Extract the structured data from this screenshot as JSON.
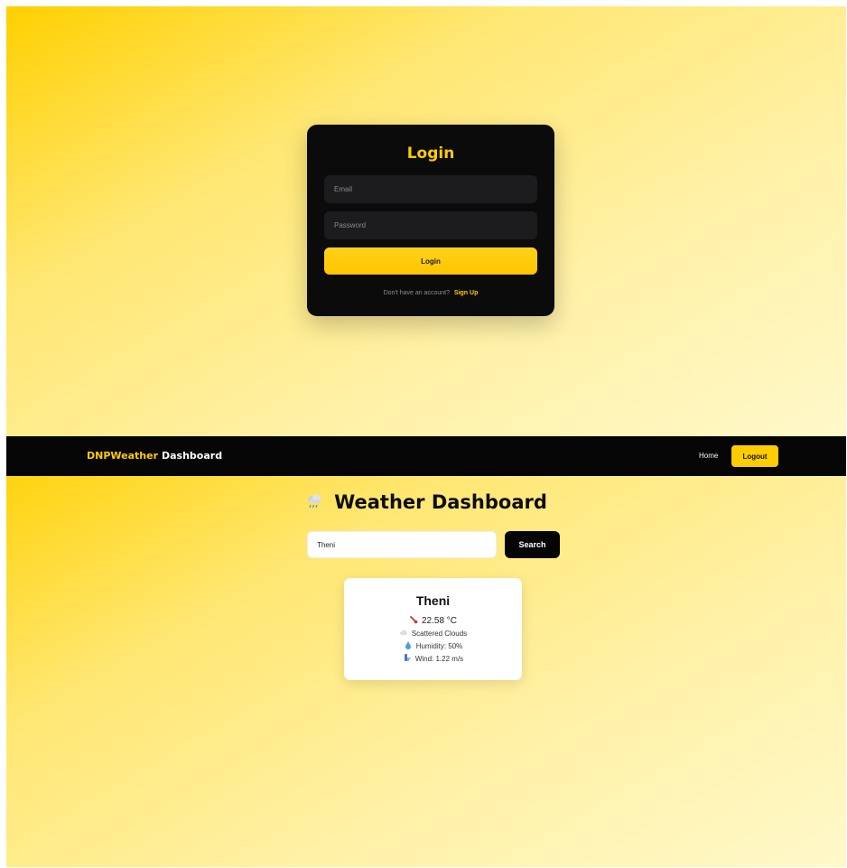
{
  "login": {
    "title": "Login",
    "email_placeholder": "Email",
    "password_placeholder": "Password",
    "submit_label": "Login",
    "signup_prompt": "Don't have an account?",
    "signup_link": "Sign Up"
  },
  "navbar": {
    "brand_accent": "DNPWeather",
    "brand_rest": "Dashboard",
    "home_label": "Home",
    "logout_label": "Logout"
  },
  "dashboard": {
    "title": "Weather Dashboard",
    "title_icon": "cloud-rain-icon",
    "search_value": "Theni",
    "search_button": "Search"
  },
  "weather": {
    "city": "Theni",
    "temperature": "22.58 °C",
    "condition": "Scattered Clouds",
    "humidity": "Humidity: 50%",
    "wind": "Wind: 1.22 m/s",
    "icons": [
      "thermometer-icon",
      "cloud-icon",
      "droplet-icon",
      "wind-icon"
    ]
  },
  "colors": {
    "accent": "#ffcc00",
    "dark": "#0b0b0c",
    "background_gradient": [
      "#ffd000",
      "#fff8c9"
    ]
  }
}
